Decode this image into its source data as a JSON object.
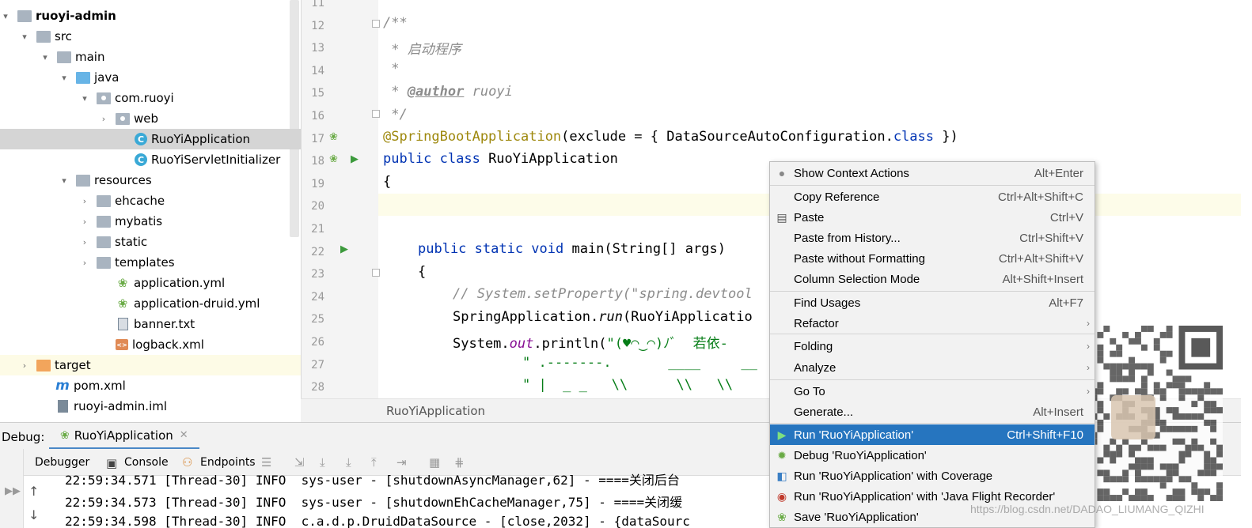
{
  "project_tree": {
    "items": [
      {
        "label": "ruoyi-admin",
        "arrow": "▾",
        "icon": "module-folder-icon",
        "bold": true
      },
      {
        "label": "src",
        "arrow": "▾",
        "icon": "folder-icon"
      },
      {
        "label": "main",
        "arrow": "▾",
        "icon": "folder-icon"
      },
      {
        "label": "java",
        "arrow": "▾",
        "icon": "source-folder-icon"
      },
      {
        "label": "com.ruoyi",
        "arrow": "▾",
        "icon": "package-icon"
      },
      {
        "label": "web",
        "arrow": "›",
        "icon": "package-icon"
      },
      {
        "label": "RuoYiApplication",
        "arrow": "",
        "icon": "class-icon",
        "selected": true
      },
      {
        "label": "RuoYiServletInitializer",
        "arrow": "",
        "icon": "class-icon"
      },
      {
        "label": "resources",
        "arrow": "▾",
        "icon": "resources-folder-icon"
      },
      {
        "label": "ehcache",
        "arrow": "›",
        "icon": "folder-icon"
      },
      {
        "label": "mybatis",
        "arrow": "›",
        "icon": "folder-icon"
      },
      {
        "label": "static",
        "arrow": "›",
        "icon": "folder-icon"
      },
      {
        "label": "templates",
        "arrow": "›",
        "icon": "folder-icon"
      },
      {
        "label": "application.yml",
        "arrow": "",
        "icon": "yml-icon"
      },
      {
        "label": "application-druid.yml",
        "arrow": "",
        "icon": "yml-icon"
      },
      {
        "label": "banner.txt",
        "arrow": "",
        "icon": "text-file-icon"
      },
      {
        "label": "logback.xml",
        "arrow": "",
        "icon": "xml-file-icon"
      },
      {
        "label": "target",
        "arrow": "›",
        "icon": "excluded-folder-icon"
      },
      {
        "label": "pom.xml",
        "arrow": "",
        "icon": "maven-icon"
      },
      {
        "label": "ruoyi-admin.iml",
        "arrow": "",
        "icon": "iml-file-icon"
      }
    ]
  },
  "editor": {
    "line_numbers": [
      "11",
      "12",
      "13",
      "14",
      "15",
      "16",
      "17",
      "18",
      "19",
      "20",
      "21",
      "22",
      "23",
      "24",
      "25",
      "26",
      "27",
      "28"
    ],
    "lines": {
      "l12": "/**",
      "l13": " * 启动程序",
      "l14": " *",
      "l15_pre": " * ",
      "l15_tag": "@author",
      "l15_post": " ruoyi",
      "l16": " */",
      "l17_ann": "@SpringBootApplication",
      "l17_mid": "(exclude = { DataSourceAutoConfiguration.",
      "l17_kw": "class",
      "l17_end": " })",
      "l18_kw": "public class",
      "l18_rest": " RuoYiApplication",
      "l19": "{",
      "l22_kw": "public static void",
      "l22_rest": " main(String[] args)",
      "l23": "{",
      "l24": "// System.setProperty(\"spring.devtool",
      "l25_a": "SpringApplication.",
      "l25_b": "run",
      "l25_c": "(RuoYiApplicatio",
      "l26_a": "System.",
      "l26_b": "out",
      "l26_c": ".println(",
      "l26_d": "\"(♥◠‿◠)ﾉﾞ  若依-",
      "l27": "\" .-------.       ____     __",
      "l28": "\" |  _ _   \\\\      \\\\   \\\\"
    },
    "breadcrumb": "RuoYiApplication"
  },
  "debug": {
    "title": "Debug:",
    "tab_label": "RuoYiApplication",
    "toolbar": {
      "debugger": "Debugger",
      "console": "Console",
      "endpoints": "Endpoints"
    },
    "log_lines": [
      "22:59:34.571 [Thread-30] INFO  sys-user - [shutdownAsyncManager,62] - ====关闭后台",
      "22:59:34.573 [Thread-30] INFO  sys-user - [shutdownEhCacheManager,75] - ====关闭缓",
      "22:59:34.598 [Thread-30] INFO  c.a.d.p.DruidDataSource - [close,2032] - {dataSourc"
    ]
  },
  "context_menu": {
    "items": [
      {
        "label": "Show Context Actions",
        "shortcut": "Alt+Enter",
        "icon": "bulb-icon"
      },
      {
        "label": "Copy Reference",
        "shortcut": "Ctrl+Alt+Shift+C"
      },
      {
        "label": "Paste",
        "shortcut": "Ctrl+V",
        "icon": "clipboard-icon"
      },
      {
        "label": "Paste from History...",
        "shortcut": "Ctrl+Shift+V"
      },
      {
        "label": "Paste without Formatting",
        "shortcut": "Ctrl+Alt+Shift+V"
      },
      {
        "label": "Column Selection Mode",
        "shortcut": "Alt+Shift+Insert"
      },
      {
        "label": "Find Usages",
        "shortcut": "Alt+F7"
      },
      {
        "label": "Refactor",
        "shortcut": "",
        "submenu": true
      },
      {
        "label": "Folding",
        "shortcut": "",
        "submenu": true
      },
      {
        "label": "Analyze",
        "shortcut": "",
        "submenu": true
      },
      {
        "label": "Go To",
        "shortcut": "",
        "submenu": true
      },
      {
        "label": "Generate...",
        "shortcut": "Alt+Insert"
      },
      {
        "label": "Run 'RuoYiApplication'",
        "shortcut": "Ctrl+Shift+F10",
        "icon": "run-icon",
        "active": true
      },
      {
        "label": "Debug 'RuoYiApplication'",
        "shortcut": "",
        "icon": "debug-icon"
      },
      {
        "label": "Run 'RuoYiApplication' with Coverage",
        "shortcut": "",
        "icon": "coverage-icon"
      },
      {
        "label": "Run 'RuoYiApplication' with 'Java Flight Recorder'",
        "shortcut": "",
        "icon": "profiler-icon"
      },
      {
        "label": "Save 'RuoYiApplication'",
        "shortcut": "",
        "icon": "save-config-icon"
      }
    ]
  },
  "watermark": "https://blog.csdn.net/DADAO_LIUMANG_QIZHI",
  "colors": {
    "selection": "#2675bf",
    "keyword": "#0033b3",
    "annotation": "#9e880d",
    "string": "#067d17",
    "comment": "#8c8c8c"
  }
}
